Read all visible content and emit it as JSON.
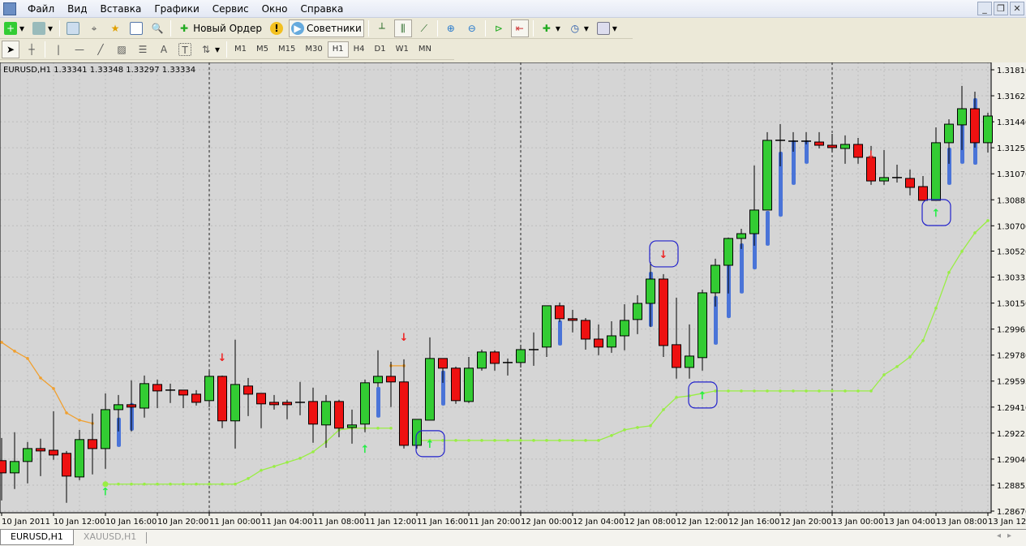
{
  "menubar": {
    "items": [
      "Файл",
      "Вид",
      "Вставка",
      "Графики",
      "Сервис",
      "Окно",
      "Справка"
    ]
  },
  "window_controls": {
    "minimize": "_",
    "restore": "❐",
    "close": "✕"
  },
  "toolbar1": {
    "new_order_label": "Новый Ордер",
    "experts_label": "Советники"
  },
  "toolbar2": {
    "timeframes": [
      "M1",
      "M5",
      "M15",
      "M30",
      "H1",
      "H4",
      "D1",
      "W1",
      "MN"
    ],
    "active_timeframe": "H1"
  },
  "chart": {
    "header": "EURUSD,H1  1.33341 1.33348 1.33297 1.33334"
  },
  "tabs": [
    {
      "label": "EURUSD,H1",
      "active": true
    },
    {
      "label": "XAUUSD,H1",
      "active": false
    }
  ],
  "colors": {
    "background": "#d5d5d5",
    "bull": "#33cc33",
    "bear": "#ee1111",
    "shadow_bars": "#4a74d8",
    "trail_line": "#99ee44",
    "upper_line": "#f0a030",
    "buy_arrow": "#22ee44",
    "sell_arrow": "#ee2222",
    "highlight_box": "#2222cc"
  },
  "chart_data": {
    "type": "candlestick",
    "symbol": "EURUSD",
    "timeframe": "H1",
    "ylim": [
      1.2867,
      1.3181
    ],
    "y_ticks": [
      "1.31810",
      "1.31625",
      "1.31440",
      "1.31255",
      "1.31070",
      "1.30885",
      "1.30700",
      "1.30520",
      "1.30335",
      "1.30150",
      "1.29965",
      "1.29780",
      "1.29595",
      "1.29410",
      "1.29225",
      "1.29040",
      "1.28855",
      "1.28670"
    ],
    "x_tick_labels": [
      "10 Jan 2011",
      "10 Jan 12:00",
      "10 Jan 16:00",
      "10 Jan 20:00",
      "11 Jan 00:00",
      "11 Jan 04:00",
      "11 Jan 08:00",
      "11 Jan 12:00",
      "11 Jan 16:00",
      "11 Jan 20:00",
      "12 Jan 00:00",
      "12 Jan 04:00",
      "12 Jan 08:00",
      "12 Jan 12:00",
      "12 Jan 16:00",
      "12 Jan 20:00",
      "13 Jan 00:00",
      "13 Jan 04:00",
      "13 Jan 08:00",
      "13 Jan 12:00"
    ],
    "x_tick_every_bars": 4,
    "day_separator_bars": [
      16,
      40,
      64
    ],
    "grid": true,
    "ohlc": [
      [
        1.29029,
        1.2919,
        1.28746,
        1.28942
      ],
      [
        1.28942,
        1.29231,
        1.28827,
        1.29023
      ],
      [
        1.29023,
        1.29162,
        1.28867,
        1.29115
      ],
      [
        1.29115,
        1.29185,
        1.28919,
        1.29098
      ],
      [
        1.29103,
        1.29381,
        1.29035,
        1.29069
      ],
      [
        1.29081,
        1.29098,
        1.28729,
        1.28919
      ],
      [
        1.28913,
        1.29248,
        1.2889,
        1.29179
      ],
      [
        1.29179,
        1.29364,
        1.28931,
        1.29115
      ],
      [
        1.29115,
        1.29508,
        1.28971,
        1.29392
      ],
      [
        1.29392,
        1.29496,
        1.29237,
        1.29427
      ],
      [
        1.29427,
        1.296,
        1.29237,
        1.2941
      ],
      [
        1.29403,
        1.29635,
        1.29335,
        1.29577
      ],
      [
        1.29571,
        1.29606,
        1.29403,
        1.29525
      ],
      [
        1.29531,
        1.29577,
        1.29439,
        1.29531
      ],
      [
        1.29531,
        1.29531,
        1.29403,
        1.29496
      ],
      [
        1.29502,
        1.29531,
        1.29421,
        1.29444
      ],
      [
        1.29456,
        1.29669,
        1.2941,
        1.29629
      ],
      [
        1.29629,
        1.29635,
        1.2926,
        1.29312
      ],
      [
        1.29312,
        1.29889,
        1.29115,
        1.29571
      ],
      [
        1.2956,
        1.29617,
        1.29346,
        1.29502
      ],
      [
        1.29508,
        1.29508,
        1.2926,
        1.29433
      ],
      [
        1.29444,
        1.29496,
        1.29392,
        1.29427
      ],
      [
        1.29444,
        1.29462,
        1.29323,
        1.29427
      ],
      [
        1.29444,
        1.29589,
        1.29352,
        1.29444
      ],
      [
        1.2945,
        1.29548,
        1.29156,
        1.29289
      ],
      [
        1.29283,
        1.29496,
        1.29121,
        1.2945
      ],
      [
        1.2945,
        1.29462,
        1.29196,
        1.2926
      ],
      [
        1.29265,
        1.29392,
        1.2915,
        1.29283
      ],
      [
        1.29289,
        1.29606,
        1.29231,
        1.29583
      ],
      [
        1.29583,
        1.29814,
        1.29554,
        1.29629
      ],
      [
        1.29629,
        1.29733,
        1.2941,
        1.29589
      ],
      [
        1.29589,
        1.2975,
        1.29115,
        1.29138
      ],
      [
        1.29138,
        1.29323,
        1.29115,
        1.29323
      ],
      [
        1.29317,
        1.29906,
        1.29317,
        1.29756
      ],
      [
        1.29756,
        1.29756,
        1.29583,
        1.29687
      ],
      [
        1.29687,
        1.29698,
        1.29433,
        1.29456
      ],
      [
        1.2945,
        1.29767,
        1.29439,
        1.29687
      ],
      [
        1.29687,
        1.29819,
        1.29669,
        1.29802
      ],
      [
        1.29802,
        1.29814,
        1.29669,
        1.29721
      ],
      [
        1.29727,
        1.29756,
        1.29635,
        1.29727
      ],
      [
        1.29727,
        1.29854,
        1.29692,
        1.29819
      ],
      [
        1.29819,
        1.29941,
        1.29704,
        1.29819
      ],
      [
        1.29837,
        1.30131,
        1.29767,
        1.30131
      ],
      [
        1.30131,
        1.30154,
        1.30016,
        1.30039
      ],
      [
        1.30039,
        1.30102,
        1.29941,
        1.30027
      ],
      [
        1.30027,
        1.30044,
        1.29819,
        1.29894
      ],
      [
        1.29894,
        1.29998,
        1.29779,
        1.29837
      ],
      [
        1.29837,
        1.30021,
        1.29796,
        1.29917
      ],
      [
        1.29917,
        1.30142,
        1.29814,
        1.30027
      ],
      [
        1.30033,
        1.30206,
        1.29929,
        1.30148
      ],
      [
        1.30148,
        1.30442,
        1.29981,
        1.30321
      ],
      [
        1.30321,
        1.30356,
        1.29767,
        1.29848
      ],
      [
        1.29854,
        1.30189,
        1.29612,
        1.29692
      ],
      [
        1.29692,
        1.29998,
        1.29612,
        1.29773
      ],
      [
        1.29762,
        1.30246,
        1.29669,
        1.30223
      ],
      [
        1.30223,
        1.30466,
        1.30125,
        1.30419
      ],
      [
        1.30419,
        1.30616,
        1.30218,
        1.3061
      ],
      [
        1.3061,
        1.30679,
        1.30535,
        1.30644
      ],
      [
        1.30644,
        1.31129,
        1.30558,
        1.30812
      ],
      [
        1.30812,
        1.31366,
        1.30812,
        1.31308
      ],
      [
        1.31308,
        1.31423,
        1.31123,
        1.31308
      ],
      [
        1.31302,
        1.31366,
        1.31227,
        1.31302
      ],
      [
        1.31302,
        1.31366,
        1.31279,
        1.31302
      ],
      [
        1.31296,
        1.31366,
        1.3125,
        1.31273
      ],
      [
        1.31273,
        1.31354,
        1.31221,
        1.31256
      ],
      [
        1.3125,
        1.31343,
        1.31141,
        1.31279
      ],
      [
        1.31279,
        1.31325,
        1.31141,
        1.31187
      ],
      [
        1.31187,
        1.31268,
        1.30991,
        1.31019
      ],
      [
        1.31019,
        1.31239,
        1.30991,
        1.31043
      ],
      [
        1.31043,
        1.31135,
        1.31008,
        1.31043
      ],
      [
        1.31037,
        1.311,
        1.30916,
        1.30973
      ],
      [
        1.30979,
        1.31054,
        1.30881,
        1.30881
      ],
      [
        1.30881,
        1.314,
        1.30881,
        1.31291
      ],
      [
        1.31291,
        1.31458,
        1.31141,
        1.31423
      ],
      [
        1.31418,
        1.31695,
        1.31239,
        1.31533
      ],
      [
        1.31533,
        1.31654,
        1.31256,
        1.31291
      ],
      [
        1.31291,
        1.31504,
        1.31221,
        1.31481
      ]
    ],
    "shadow_bars": [
      [
        9,
        1.29335,
        1.29127
      ],
      [
        10,
        1.29439,
        1.29242
      ],
      [
        29,
        1.29554,
        1.29335
      ],
      [
        34,
        1.2967,
        1.29421
      ],
      [
        43,
        1.30027,
        1.29848
      ],
      [
        50,
        1.30373,
        1.29981
      ],
      [
        55,
        1.302,
        1.29854
      ],
      [
        56,
        1.30419,
        1.30044
      ],
      [
        57,
        1.30575,
        1.30218
      ],
      [
        58,
        1.3065,
        1.3039
      ],
      [
        59,
        1.30806,
        1.30558
      ],
      [
        60,
        1.31227,
        1.30765
      ],
      [
        61,
        1.31308,
        1.30991
      ],
      [
        62,
        1.31308,
        1.31141
      ],
      [
        73,
        1.31256,
        1.30991
      ],
      [
        74,
        1.31423,
        1.31141
      ],
      [
        75,
        1.31608,
        1.31135
      ]
    ],
    "upper_line": [
      [
        0,
        1.29871
      ],
      [
        1,
        1.29808
      ],
      [
        2,
        1.29756
      ],
      [
        3,
        1.29617
      ],
      [
        4,
        1.29542
      ],
      [
        5,
        1.29369
      ],
      [
        6,
        1.29317
      ],
      [
        7,
        1.29294
      ]
    ],
    "upper_line_2": [
      [
        30,
        1.29704
      ],
      [
        31,
        1.29704
      ]
    ],
    "trail_line_1": [
      [
        8,
        1.28862
      ],
      [
        9,
        1.28862
      ],
      [
        10,
        1.28862
      ],
      [
        11,
        1.28862
      ],
      [
        12,
        1.28862
      ],
      [
        13,
        1.28862
      ],
      [
        14,
        1.28862
      ],
      [
        15,
        1.28862
      ],
      [
        16,
        1.28862
      ],
      [
        17,
        1.28862
      ],
      [
        18,
        1.28862
      ],
      [
        19,
        1.28902
      ],
      [
        20,
        1.2896
      ],
      [
        21,
        1.28988
      ],
      [
        22,
        1.29017
      ],
      [
        23,
        1.29046
      ],
      [
        24,
        1.29092
      ],
      [
        25,
        1.29162
      ],
      [
        26,
        1.29248
      ],
      [
        27,
        1.2926
      ],
      [
        28,
        1.2926
      ],
      [
        29,
        1.2926
      ],
      [
        30,
        1.2926
      ]
    ],
    "trail_line_2": [
      [
        32,
        1.29173
      ],
      [
        33,
        1.29173
      ],
      [
        34,
        1.29173
      ],
      [
        35,
        1.29173
      ],
      [
        36,
        1.29173
      ],
      [
        37,
        1.29173
      ],
      [
        38,
        1.29173
      ],
      [
        39,
        1.29173
      ],
      [
        40,
        1.29173
      ],
      [
        41,
        1.29173
      ],
      [
        42,
        1.29173
      ],
      [
        43,
        1.29173
      ],
      [
        44,
        1.29173
      ],
      [
        45,
        1.29173
      ],
      [
        46,
        1.29173
      ],
      [
        47,
        1.29208
      ],
      [
        48,
        1.29248
      ],
      [
        49,
        1.29265
      ],
      [
        50,
        1.29277
      ],
      [
        51,
        1.29392
      ],
      [
        52,
        1.29479
      ],
      [
        53,
        1.2949
      ],
      [
        54,
        1.29508
      ],
      [
        55,
        1.29525
      ],
      [
        56,
        1.29525
      ],
      [
        57,
        1.29525
      ],
      [
        58,
        1.29525
      ],
      [
        59,
        1.29525
      ],
      [
        60,
        1.29525
      ],
      [
        61,
        1.29525
      ],
      [
        62,
        1.29525
      ],
      [
        63,
        1.29525
      ],
      [
        64,
        1.29525
      ],
      [
        65,
        1.29525
      ],
      [
        66,
        1.29525
      ],
      [
        67,
        1.29525
      ],
      [
        68,
        1.2964
      ],
      [
        69,
        1.29698
      ],
      [
        70,
        1.29767
      ],
      [
        71,
        1.29883
      ],
      [
        72,
        1.30114
      ],
      [
        73,
        1.30368
      ],
      [
        74,
        1.30518
      ],
      [
        75,
        1.3065
      ],
      [
        76,
        1.30737
      ]
    ],
    "signals": [
      {
        "bar": 8,
        "type": "buy",
        "price": 1.2881,
        "boxed": false
      },
      {
        "bar": 17,
        "type": "sell",
        "price": 1.29767,
        "boxed": false
      },
      {
        "bar": 28,
        "type": "buy",
        "price": 1.29115,
        "boxed": false
      },
      {
        "bar": 31,
        "type": "sell",
        "price": 1.29912,
        "boxed": false
      },
      {
        "bar": 33,
        "type": "buy",
        "price": 1.2915,
        "boxed": true
      },
      {
        "bar": 51,
        "type": "sell",
        "price": 1.305,
        "boxed": true
      },
      {
        "bar": 54,
        "type": "buy",
        "price": 1.29496,
        "boxed": true
      },
      {
        "bar": 67,
        "type": "sell",
        "price": 1.3121,
        "boxed": false
      },
      {
        "bar": 72,
        "type": "buy",
        "price": 1.30794,
        "boxed": true
      }
    ]
  }
}
